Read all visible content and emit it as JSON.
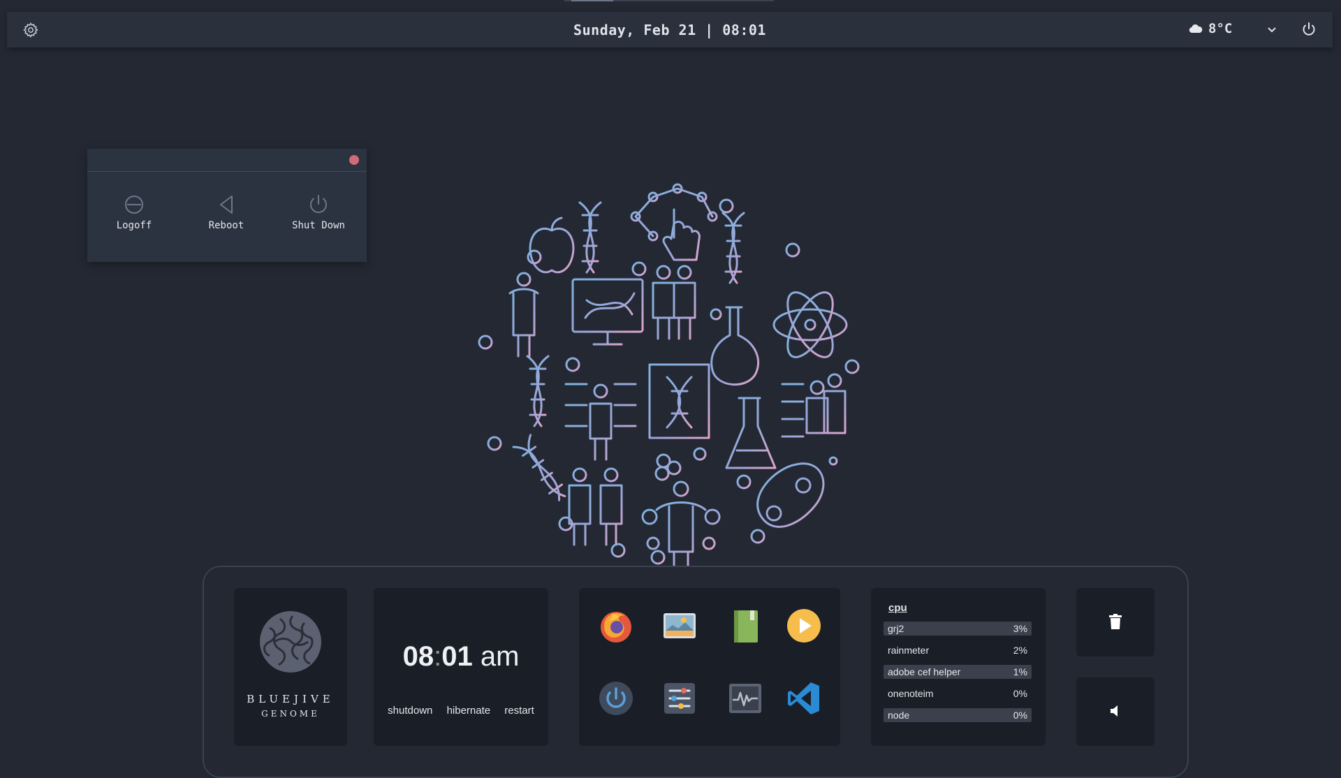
{
  "topbar": {
    "date_time": "Sunday, Feb 21 | 08:01",
    "temperature": "8°C",
    "icons": {
      "left": "settings-gear-icon",
      "weather": "cloud-icon",
      "menu": "chevron-down-icon",
      "power": "power-icon"
    }
  },
  "power_dialog": {
    "options": [
      {
        "label": "Logoff",
        "icon": "logoff-icon"
      },
      {
        "label": "Reboot",
        "icon": "reboot-icon"
      },
      {
        "label": "Shut Down",
        "icon": "shutdown-icon"
      }
    ],
    "close_color": "#d16b78"
  },
  "dock": {
    "logo": {
      "line1": "BLUEJIVE",
      "line2": "GENOME"
    },
    "clock": {
      "hours": "08",
      "minutes": "01",
      "meridiem": "am"
    },
    "clock_links": [
      "shutdown",
      "hibernate",
      "restart"
    ],
    "apps": [
      {
        "name": "firefox",
        "icon": "firefox-icon"
      },
      {
        "name": "image viewer",
        "icon": "image-viewer-icon"
      },
      {
        "name": "notes",
        "icon": "book-icon"
      },
      {
        "name": "media player",
        "icon": "play-icon"
      },
      {
        "name": "power",
        "icon": "power-icon"
      },
      {
        "name": "settings",
        "icon": "sliders-icon"
      },
      {
        "name": "system monitor",
        "icon": "system-monitor-icon"
      },
      {
        "name": "vs code",
        "icon": "vscode-icon"
      }
    ],
    "cpu": {
      "title": "cpu",
      "processes": [
        {
          "name": "grj2",
          "percent": "3%"
        },
        {
          "name": "rainmeter",
          "percent": "2%"
        },
        {
          "name": "adobe cef helper",
          "percent": "1%"
        },
        {
          "name": "onenoteim",
          "percent": "0%"
        },
        {
          "name": "node",
          "percent": "0%"
        }
      ]
    },
    "buttons": [
      {
        "icon": "trash-icon"
      },
      {
        "icon": "volume-icon"
      }
    ]
  },
  "colors": {
    "background": "#232833",
    "topbar": "#2a303c",
    "card": "#1a1e27",
    "art_blue": "#7fb0dc",
    "art_pink": "#d9a0c4"
  }
}
